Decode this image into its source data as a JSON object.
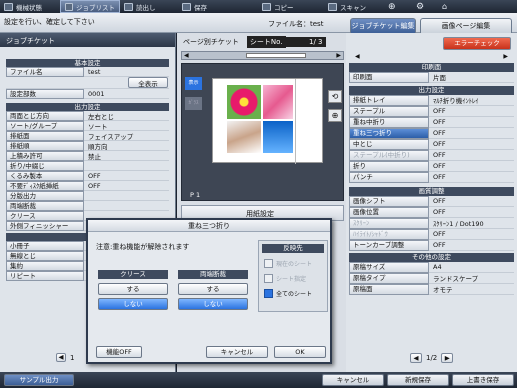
{
  "topbar": {
    "items": [
      {
        "label": "機械状態",
        "icon": "machine-icon"
      },
      {
        "label": "ジョブリスト",
        "icon": "list-icon",
        "active": true
      },
      {
        "label": "読出し",
        "icon": "read-icon"
      },
      {
        "label": "保存",
        "icon": "save-icon"
      },
      {
        "label": "コピー",
        "icon": "copy-icon"
      },
      {
        "label": "スキャン",
        "icon": "scan-icon"
      }
    ]
  },
  "status": {
    "message": "設定を行い、確定して下さい",
    "filename": "ファイル名：test"
  },
  "tabs": {
    "job_ticket_edit": "ジョブチケット編集",
    "image_page_edit": "画像ページ編集"
  },
  "left": {
    "header": "ジョブチケット",
    "basic_section": "基本設定",
    "filename_key": "ファイル名",
    "filename_val": "test",
    "show_all": "全表示",
    "set_count_key": "設定部数",
    "set_count_val": "0001",
    "output_section": "出力設定",
    "rows": [
      {
        "k": "両面とじ方向",
        "v": "左右とじ"
      },
      {
        "k": "ソート/グループ",
        "v": "ソート"
      },
      {
        "k": "排紙面",
        "v": "フェイスアップ"
      },
      {
        "k": "排紙順",
        "v": "順方向"
      },
      {
        "k": "上積み許可",
        "v": "禁止"
      },
      {
        "k": "折り/中綴じ",
        "v": ""
      },
      {
        "k": "くるみ製本",
        "v": "OFF"
      },
      {
        "k": "不要ﾃﾞｨｽｸ紙挿紙",
        "v": "OFF"
      },
      {
        "k": "分版出力",
        "v": ""
      },
      {
        "k": "両端断裁",
        "v": ""
      },
      {
        "k": "クリース",
        "v": ""
      },
      {
        "k": "外側フィニッシャー",
        "v": ""
      }
    ],
    "app_section": "応用",
    "app_rows": [
      "小冊子",
      "無線とじ",
      "集約",
      "リピート"
    ],
    "pager": "1"
  },
  "center": {
    "header": "ページ別チケット",
    "sheet_no_label": "シートNo.",
    "sheet_no": "1/ 3",
    "page_label": "P 1",
    "paper_settings": "用紙設定"
  },
  "right": {
    "error_check": "エラーチェック",
    "print_section": "印刷面",
    "print_face_key": "印刷面",
    "print_face_val": "片面",
    "output_section": "出力設定",
    "out_rows": [
      {
        "k": "排紙トレイ",
        "v": "ﾏﾙﾁ折り機ｲﾝﾄﾚｲ"
      },
      {
        "k": "ステープル",
        "v": "OFF"
      },
      {
        "k": "重ね中折り",
        "v": "OFF"
      },
      {
        "k": "重ね三つ折り",
        "v": "OFF",
        "sel": true
      },
      {
        "k": "中とじ",
        "v": "OFF"
      },
      {
        "k": "ステープル(中折り)",
        "v": "OFF",
        "dis": true
      },
      {
        "k": "折り",
        "v": "OFF"
      },
      {
        "k": "パンチ",
        "v": "OFF"
      }
    ],
    "image_section": "画質調整",
    "img_rows": [
      {
        "k": "画像シフト",
        "v": "OFF"
      },
      {
        "k": "画像位置",
        "v": "OFF"
      },
      {
        "k": "ｽｸﾘｰﾝ",
        "v": "ｽｸﾘｰﾝ1 / Dot190",
        "dis": true
      },
      {
        "k": "ﾊｲﾗｲﾄ/ｼｬﾄﾞｳ",
        "v": "OFF",
        "dis": true
      },
      {
        "k": "トーンカーブ調整",
        "v": "OFF"
      }
    ],
    "other_section": "その他の設定",
    "other_rows": [
      {
        "k": "原稿サイズ",
        "v": "A4"
      },
      {
        "k": "原稿タイプ",
        "v": "ランドスケープ"
      },
      {
        "k": "原稿面",
        "v": "オモテ"
      }
    ],
    "pager": "1/2"
  },
  "dialog": {
    "title": "重ね三つ折り",
    "note": "注意:重ね機能が解除されます",
    "crease_header": "クリース",
    "trim_header": "両端断裁",
    "on": "する",
    "off": "しない",
    "apply_header": "反映先",
    "apply_opts": [
      "現在のシート",
      "シート指定",
      "全てのシート"
    ],
    "func_off": "機能OFF",
    "cancel": "キャンセル",
    "ok": "OK"
  },
  "bottom": {
    "sample": "サンプル出力",
    "cancel": "キャンセル",
    "new_save": "新規保存",
    "overwrite": "上書き保存"
  }
}
